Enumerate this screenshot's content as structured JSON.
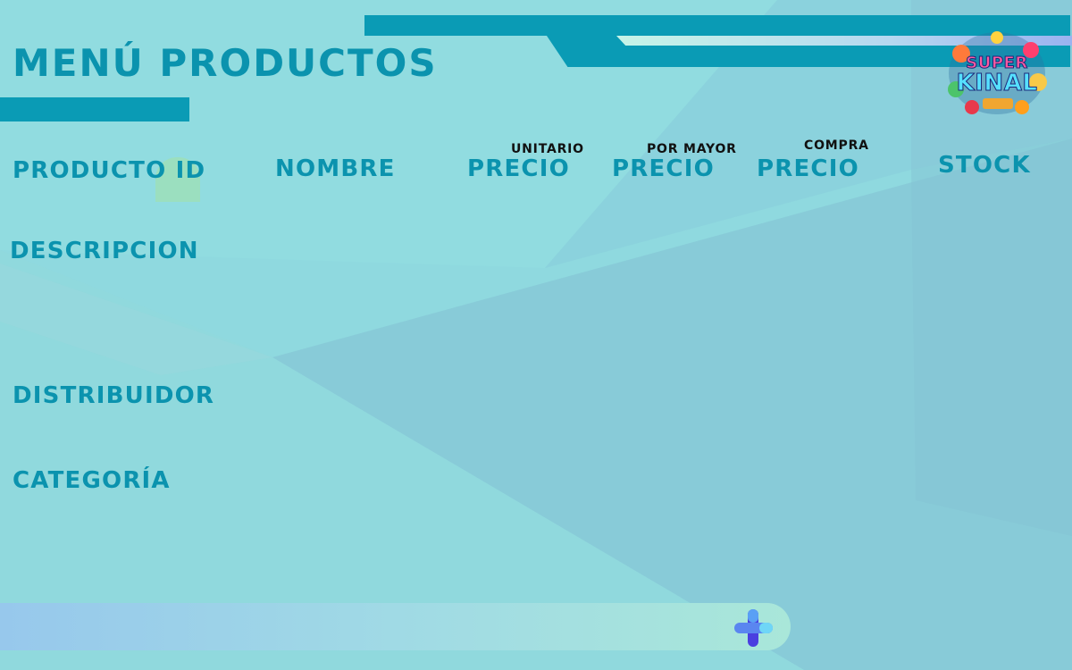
{
  "page": {
    "title": "Menú productos"
  },
  "logo": {
    "line1": "SUPER",
    "line2": "KINAL"
  },
  "form": {
    "producto_id_label": "Producto ID",
    "nombre_label": "Nombre",
    "precio_unitario_label": "Precio",
    "precio_unitario_sub": "Unitario",
    "precio_mayor_label": "Precio",
    "precio_mayor_sub": "Por mayor",
    "precio_compra_label": "Precio",
    "precio_compra_sub": "Compra",
    "stock_label": "Stock",
    "descripcion_label": "Descripcion",
    "distribuidor_label": "Distribuidor",
    "categoria_label": "Categoría"
  },
  "toolbar": {
    "add_icon": "plus-icon"
  },
  "colors": {
    "background": "#8fd9df",
    "accent": "#0a9bb5",
    "heading": "#0b93ae"
  }
}
